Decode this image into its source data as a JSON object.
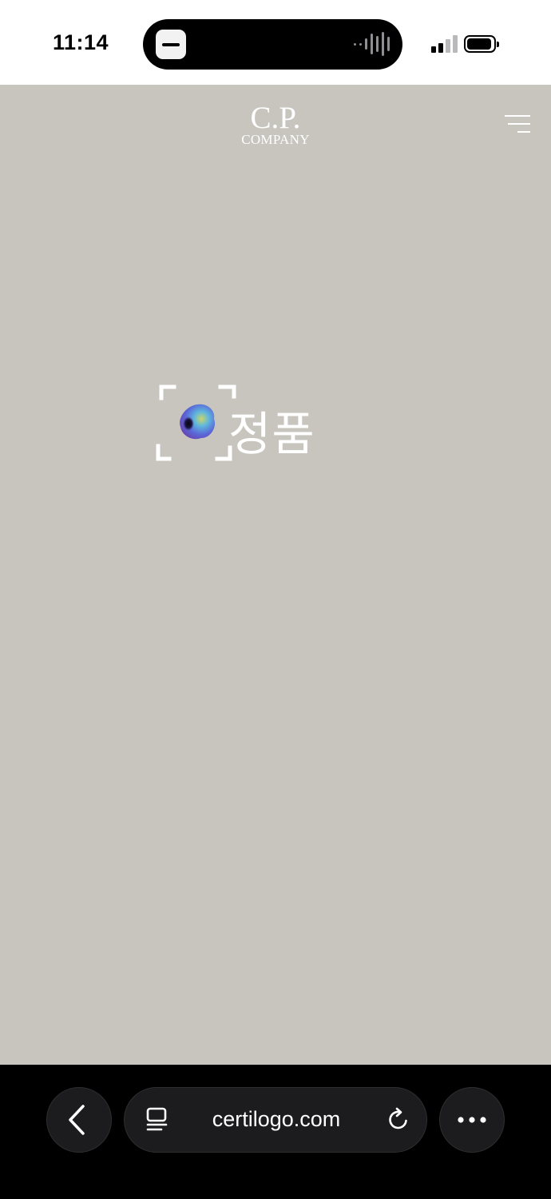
{
  "status_bar": {
    "time": "11:14"
  },
  "header": {
    "logo_line1": "C.P.",
    "logo_line2": "COMPANY"
  },
  "badge": {
    "text": "정품"
  },
  "browser": {
    "url": "certilogo.com"
  },
  "colors": {
    "page_background": "#c8c5bf",
    "toolbar_background": "#000000",
    "button_background": "#1c1c1e",
    "foreground": "#ffffff"
  },
  "icons": [
    "menu-icon",
    "scan-frame-icon",
    "certilogo-orb-icon",
    "back-chevron-icon",
    "reader-icon",
    "reload-icon",
    "more-icon",
    "signal-icon",
    "battery-icon"
  ]
}
